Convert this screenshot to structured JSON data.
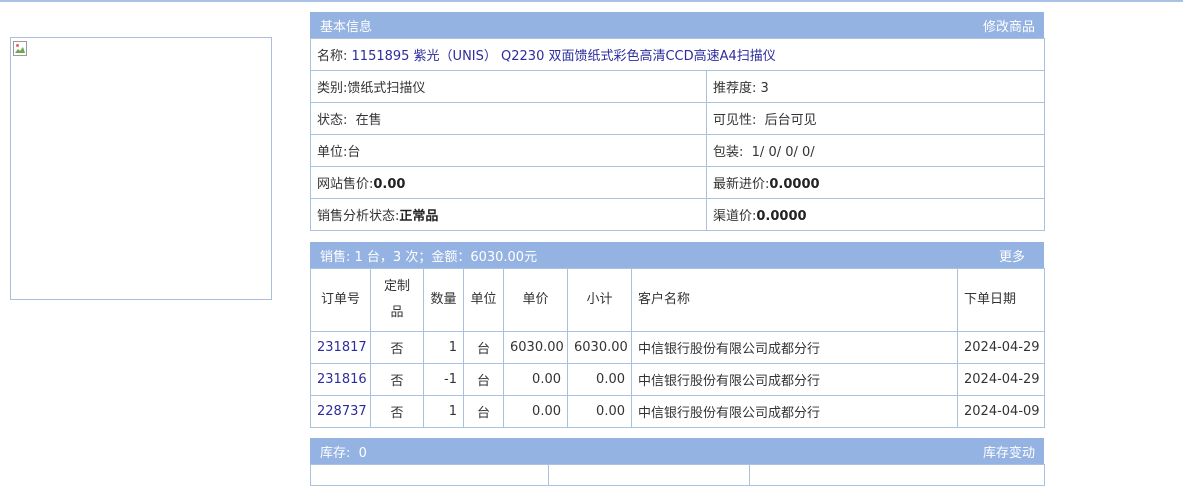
{
  "basic": {
    "header_title": "基本信息",
    "header_action": "修改商品",
    "name_label": "名称:",
    "name_value": "1151895 紫光（UNIS） Q2230 双面馈纸式彩色高清CCD高速A4扫描仪",
    "category_label": "类别:",
    "category_value": "馈纸式扫描仪",
    "recommend_label": "推荐度:",
    "recommend_value": "3",
    "status_label": "状态:",
    "status_value": "在售",
    "visibility_label": "可见性:",
    "visibility_value": "后台可见",
    "unit_label": "单位:",
    "unit_value": "台",
    "package_label": "包装:",
    "package_value": "1/ 0/ 0/ 0/",
    "web_price_label": "网站售价:",
    "web_price_value": "0.00",
    "latest_cost_label": "最新进价:",
    "latest_cost_value": "0.0000",
    "sales_status_label": "销售分析状态:",
    "sales_status_value": "正常品",
    "channel_price_label": "渠道价:",
    "channel_price_value": "0.0000"
  },
  "sales": {
    "summary": "销售: 1 台，3 次；金额：6030.00元",
    "more": "更多",
    "columns": [
      "订单号",
      "定制品",
      "数量",
      "单位",
      "单价",
      "小计",
      "客户名称",
      "下单日期"
    ],
    "rows": [
      {
        "order": "231817",
        "custom": "否",
        "qty": "1",
        "unit": "台",
        "price": "6030.00",
        "subtotal": "6030.00",
        "customer": "中信银行股份有限公司成都分行",
        "date": "2024-04-29"
      },
      {
        "order": "231816",
        "custom": "否",
        "qty": "-1",
        "unit": "台",
        "price": "0.00",
        "subtotal": "0.00",
        "customer": "中信银行股份有限公司成都分行",
        "date": "2024-04-29"
      },
      {
        "order": "228737",
        "custom": "否",
        "qty": "1",
        "unit": "台",
        "price": "0.00",
        "subtotal": "0.00",
        "customer": "中信银行股份有限公司成都分行",
        "date": "2024-04-09"
      }
    ]
  },
  "stock": {
    "summary": "库存:  0",
    "action": "库存变动"
  }
}
